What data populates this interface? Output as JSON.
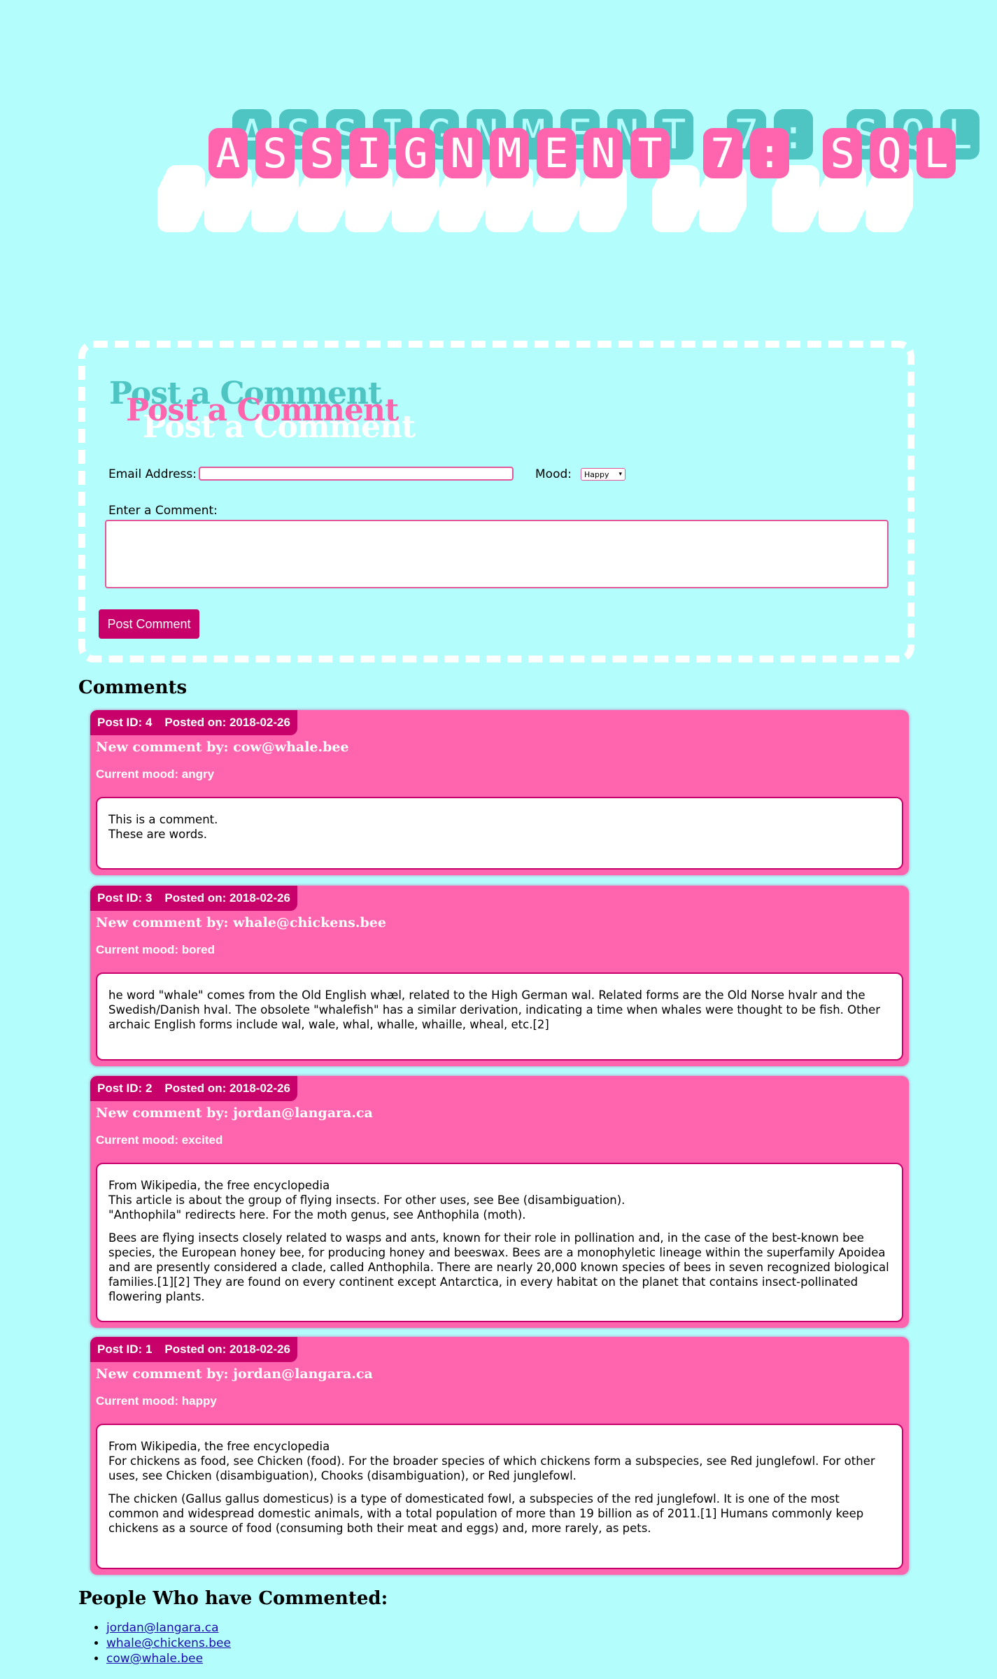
{
  "banner": {
    "title": "ASSIGNMENT 7: SQL",
    "glyphs": [
      "A",
      "S",
      "S",
      "I",
      "G",
      "N",
      "M",
      "E",
      "N",
      "T",
      " ",
      "7",
      ":",
      " ",
      "S",
      "Q",
      "L"
    ]
  },
  "form": {
    "heading": "Post a Comment",
    "email_label": "Email Address:",
    "email_value": "",
    "mood_label": "Mood:",
    "mood_selected": "Happy",
    "comment_label": "Enter a Comment:",
    "comment_value": "",
    "submit_label": "Post Comment"
  },
  "comments_section": {
    "title": "Comments",
    "items": [
      {
        "post_id_label": "Post ID: 4",
        "posted_label": "Posted on: 2018-02-26",
        "author_label": "New comment by: cow@whale.bee",
        "mood_label": "Current mood: angry",
        "paragraphs": [
          [
            "This is a comment.",
            "These are words."
          ]
        ]
      },
      {
        "post_id_label": "Post ID: 3",
        "posted_label": "Posted on: 2018-02-26",
        "author_label": "New comment by: whale@chickens.bee",
        "mood_label": "Current mood: bored",
        "paragraphs": [
          [
            "he word \"whale\" comes from the Old English whæl, related to the High German wal. Related forms are the Old Norse hvalr and the Swedish/Danish hval. The obsolete \"whalefish\" has a similar derivation, indicating a time when whales were thought to be fish. Other archaic English forms include wal, wale, whal, whalle, whaille, wheal, etc.[2]"
          ]
        ]
      },
      {
        "post_id_label": "Post ID: 2",
        "posted_label": "Posted on: 2018-02-26",
        "author_label": "New comment by: jordan@langara.ca",
        "mood_label": "Current mood: excited",
        "paragraphs": [
          [
            "From Wikipedia, the free encyclopedia",
            "This article is about the group of flying insects. For other uses, see Bee (disambiguation).",
            "\"Anthophila\" redirects here. For the moth genus, see Anthophila (moth)."
          ],
          [
            "Bees are flying insects closely related to wasps and ants, known for their role in pollination and, in the case of the best-known bee species, the European honey bee, for producing honey and beeswax. Bees are a monophyletic lineage within the superfamily Apoidea and are presently considered a clade, called Anthophila. There are nearly 20,000 known species of bees in seven recognized biological families.[1][2] They are found on every continent except Antarctica, in every habitat on the planet that contains insect-pollinated flowering plants."
          ]
        ]
      },
      {
        "post_id_label": "Post ID: 1",
        "posted_label": "Posted on: 2018-02-26",
        "author_label": "New comment by: jordan@langara.ca",
        "mood_label": "Current mood: happy",
        "paragraphs": [
          [
            "From Wikipedia, the free encyclopedia",
            "For chickens as food, see Chicken (food). For the broader species of which chickens form a subspecies, see Red junglefowl. For other uses, see Chicken (disambiguation), Chooks (disambiguation), or Red junglefowl."
          ],
          [
            "The chicken (Gallus gallus domesticus) is a type of domesticated fowl, a subspecies of the red junglefowl. It is one of the most common and widespread domestic animals, with a total population of more than 19 billion as of 2011.[1] Humans commonly keep chickens as a source of food (consuming both their meat and eggs) and, more rarely, as pets."
          ]
        ]
      }
    ]
  },
  "people_section": {
    "title": "People Who have Commented:",
    "emails": [
      "jordan@langara.ca",
      "whale@chickens.bee",
      "cow@whale.bee"
    ]
  },
  "colors": {
    "background": "#b4fdfd",
    "pink": "#ff65ae",
    "magenta": "#c8006a",
    "teal": "#4ec5c2",
    "white": "#ffffff"
  }
}
